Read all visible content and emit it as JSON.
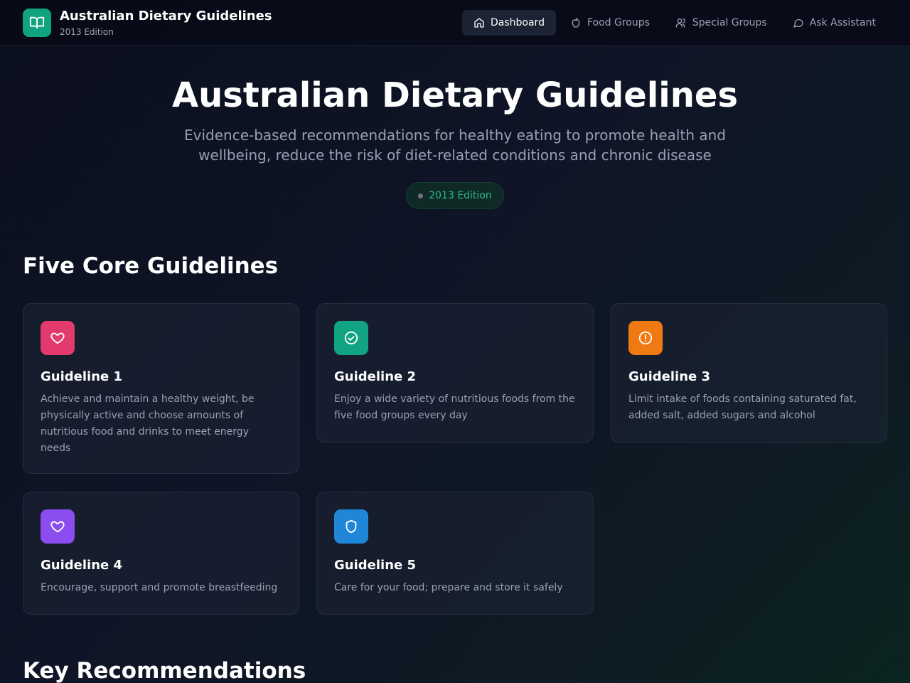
{
  "header": {
    "brand_title": "Australian Dietary Guidelines",
    "brand_subtitle": "2013 Edition",
    "logo_icon": "book-open-icon",
    "nav": [
      {
        "label": "Dashboard",
        "icon": "home-icon",
        "active": true
      },
      {
        "label": "Food Groups",
        "icon": "apple-icon",
        "active": false
      },
      {
        "label": "Special Groups",
        "icon": "users-icon",
        "active": false
      },
      {
        "label": "Ask Assistant",
        "icon": "chat-bubble-icon",
        "active": false
      }
    ]
  },
  "hero": {
    "title": "Australian Dietary Guidelines",
    "description": "Evidence-based recommendations for healthy eating to promote health and wellbeing, reduce the risk of diet-related conditions and chronic disease",
    "badge": "2013 Edition"
  },
  "guidelines_section": {
    "title": "Five Core Guidelines",
    "cards": [
      {
        "title": "Guideline 1",
        "text": "Achieve and maintain a healthy weight, be physically active and choose amounts of nutritious food and drinks to meet energy needs",
        "icon": "heart-icon",
        "color": "#e23a6c"
      },
      {
        "title": "Guideline 2",
        "text": "Enjoy a wide variety of nutritious foods from the five food groups every day",
        "icon": "check-circle-icon",
        "color": "#12a383"
      },
      {
        "title": "Guideline 3",
        "text": "Limit intake of foods containing saturated fat, added salt, added sugars and alcohol",
        "icon": "alert-circle-icon",
        "color": "#f07a12"
      },
      {
        "title": "Guideline 4",
        "text": "Encourage, support and promote breastfeeding",
        "icon": "heart-icon",
        "color": "#8b4cf0"
      },
      {
        "title": "Guideline 5",
        "text": "Care for your food; prepare and store it safely",
        "icon": "shield-icon",
        "color": "#1f86d8"
      }
    ]
  },
  "recommendations_section": {
    "title": "Key Recommendations"
  },
  "colors": {
    "accent": "#10a37f",
    "background": "#0f1526"
  }
}
